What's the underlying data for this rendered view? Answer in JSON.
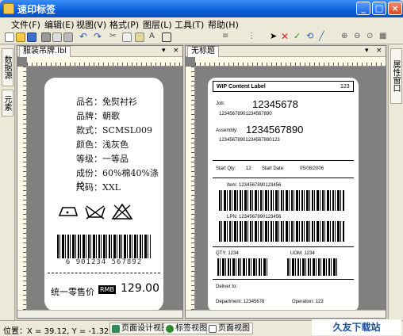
{
  "window": {
    "title": "速印标签"
  },
  "menu": [
    "文件(F)",
    "编辑(E)",
    "视图(V)",
    "格式(P)",
    "图层(L)",
    "工具(T)",
    "帮助(H)"
  ],
  "left_panel": {
    "tabs": [
      "数据源",
      "元素"
    ]
  },
  "right_panel": {
    "tabs": [
      "属性窗口"
    ]
  },
  "doc1": {
    "tab": "服装吊牌.lbl",
    "label": {
      "lines": [
        "品名：免熨衬衫",
        "品牌：朝歌",
        "款式：SCMSL009",
        "颜色：浅灰色",
        "等级：一等品",
        "成份：60%棉40%涤纶",
        "尺码：XXL"
      ],
      "barcode_text": "6 901234 567892",
      "price_label": "统一零售价",
      "currency": "RMB",
      "price": "129.00"
    }
  },
  "doc2": {
    "tab": "无标题",
    "label": {
      "header_title": "WIP Content Label",
      "header_num": "123",
      "job_label": "Job:",
      "job_value": "12345678",
      "job_small": "12345678901234567890",
      "assembly_label": "Assembly:",
      "assembly_value": "1234567890",
      "assembly_small": "12345678901234567890123",
      "start_qty_label": "Start Qty:",
      "start_qty": "12",
      "start_date_label": "Start Date:",
      "start_date": "05/08/2006",
      "item_label": "Item: 1234567890123456",
      "lpn_label": "LPN: 1234567890123456",
      "qty_label": "QTY: 1234",
      "uom_label": "UOM: 1234",
      "deliver_label": "Deliver to:",
      "department": "Department: 12345678",
      "operation": "Operation: 123"
    }
  },
  "status": {
    "position": "位置：X = 39.12, Y = -1.32",
    "tabs": [
      "页面设计视图",
      "标签视图",
      "页面视图"
    ]
  },
  "watermark": "久友下载站(www.9upk.com)",
  "colors": {
    "titlebar": "#0a5fd8",
    "accent_green": "#2e8b2e"
  }
}
